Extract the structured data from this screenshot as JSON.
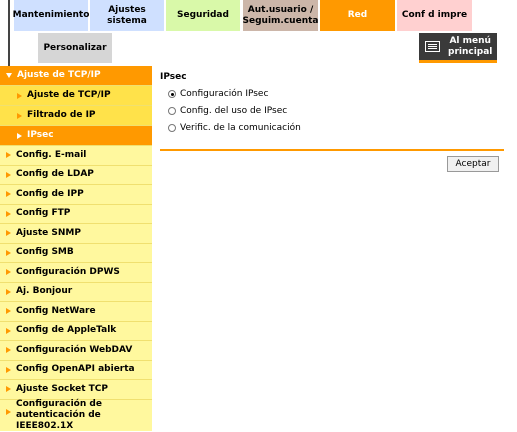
{
  "colors": {
    "tab_mantenimiento": "#cfe0ff",
    "tab_ajustes": "#cfe0ff",
    "tab_seguridad": "#d9f9a9",
    "tab_aut": "#ccb6a9",
    "tab_red": "#ff9900",
    "tab_conf": "#ffd0d0",
    "tab_personalizar": "#d6d6d6",
    "sidebar_bg": "#fff89e",
    "accent": "#ff9900"
  },
  "tabs": {
    "mantenimiento": "Mantenimiento",
    "ajustes_sistema": "Ajustes sistema",
    "seguridad": "Seguridad",
    "aut_usuario_l1": "Aut.usuario /",
    "aut_usuario_l2": "Seguim.cuenta",
    "red": "Red",
    "conf_impre": "Conf d impre",
    "personalizar": "Personalizar"
  },
  "main_menu": {
    "line1": "Al menú",
    "line2": "principal",
    "icon": "main-menu-icon"
  },
  "sidebar": {
    "items": [
      {
        "label": "Ajuste de TCP/IP"
      },
      {
        "label": "Ajuste de TCP/IP"
      },
      {
        "label": "Filtrado de IP"
      },
      {
        "label": "IPsec"
      },
      {
        "label": "Config. E-mail"
      },
      {
        "label": "Config de LDAP"
      },
      {
        "label": "Config de IPP"
      },
      {
        "label": "Config FTP"
      },
      {
        "label": "Ajuste SNMP"
      },
      {
        "label": "Config SMB"
      },
      {
        "label": "Configuración DPWS"
      },
      {
        "label": "Aj. Bonjour"
      },
      {
        "label": "Config NetWare"
      },
      {
        "label": "Config de AppleTalk"
      },
      {
        "label": "Configuración WebDAV"
      },
      {
        "label": "Config OpenAPI abierta"
      },
      {
        "label": "Ajuste Socket TCP"
      },
      {
        "label_l1": "Configuración de",
        "label_l2": "autenticación de IEEE802.1X"
      }
    ]
  },
  "content": {
    "title": "IPsec",
    "options": [
      {
        "label": "Configuración IPsec",
        "selected": true
      },
      {
        "label": "Config. del uso de IPsec",
        "selected": false
      },
      {
        "label": "Verific. de la comunicación",
        "selected": false
      }
    ],
    "accept_label": "Aceptar"
  }
}
